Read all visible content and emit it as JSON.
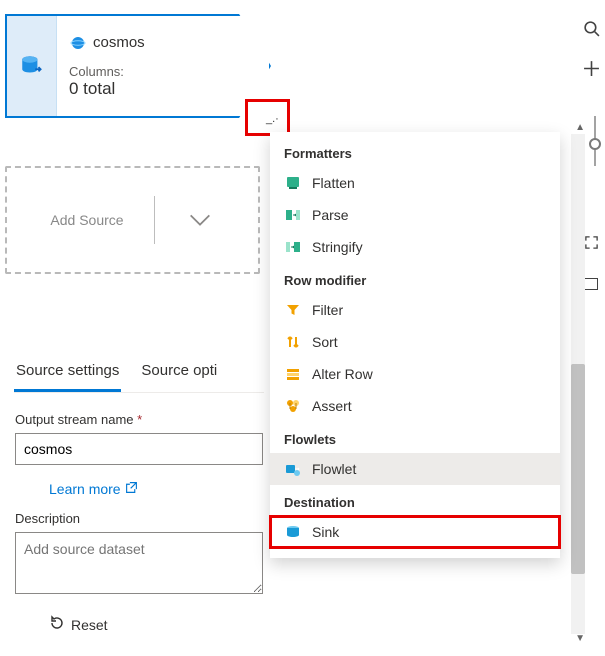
{
  "node": {
    "icon": "database-out",
    "title_icon": "cosmos-db",
    "title": "cosmos",
    "columns_label": "Columns:",
    "columns_value": "0 total"
  },
  "add_source": {
    "label": "Add Source"
  },
  "tabs": {
    "source_settings": "Source settings",
    "source_options": "Source opti"
  },
  "form": {
    "output_stream_label": "Output stream name",
    "output_stream_value": "cosmos",
    "learn_more": "Learn more",
    "description_label": "Description",
    "description_placeholder": "Add source dataset",
    "reset_label": "Reset"
  },
  "rail": {
    "search": "search-icon",
    "add": "plus-icon",
    "fullscreen": "fullscreen-icon",
    "panel": "panel-icon"
  },
  "menu": {
    "groups": [
      {
        "title": "Formatters",
        "items": [
          {
            "icon": "flatten",
            "label": "Flatten",
            "color": "#2db08a"
          },
          {
            "icon": "parse",
            "label": "Parse",
            "color": "#2db08a"
          },
          {
            "icon": "stringify",
            "label": "Stringify",
            "color": "#2db08a"
          }
        ]
      },
      {
        "title": "Row modifier",
        "items": [
          {
            "icon": "filter",
            "label": "Filter",
            "color": "#f2a100"
          },
          {
            "icon": "sort",
            "label": "Sort",
            "color": "#f2a100"
          },
          {
            "icon": "alter-row",
            "label": "Alter Row",
            "color": "#f2a100"
          },
          {
            "icon": "assert",
            "label": "Assert",
            "color": "#f2a100"
          }
        ]
      },
      {
        "title": "Flowlets",
        "items": [
          {
            "icon": "flowlet",
            "label": "Flowlet",
            "color": "#1a9ad6",
            "hover": true
          }
        ]
      },
      {
        "title": "Destination",
        "items": [
          {
            "icon": "sink",
            "label": "Sink",
            "color": "#1a9ad6",
            "highlight": true
          }
        ]
      }
    ]
  }
}
